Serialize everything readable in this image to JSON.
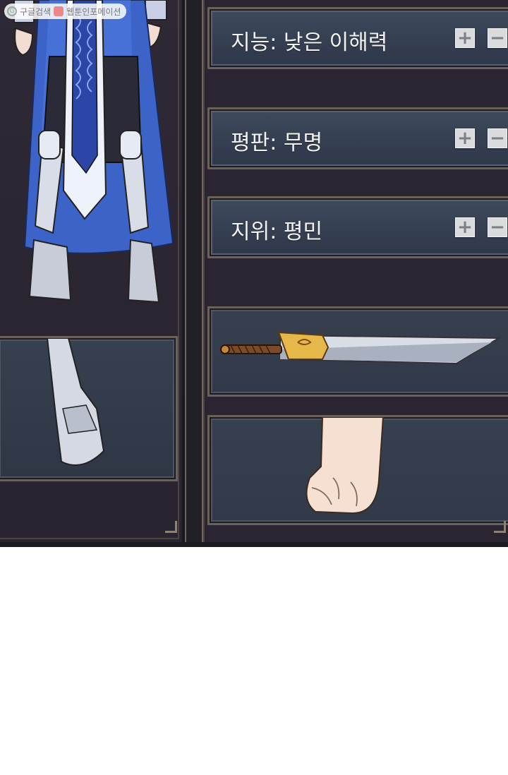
{
  "watermark": {
    "left_text": "구글검색",
    "right_text": "웹툰인포메이션"
  },
  "stats": [
    {
      "label": "지능: 낮은 이해력",
      "plus": "+",
      "minus": "−"
    },
    {
      "label": "평판: 무명",
      "plus": "+",
      "minus": "−"
    },
    {
      "label": "지위: 평민",
      "plus": "+",
      "minus": "−"
    }
  ],
  "equipment": {
    "weapon_slot": "dagger",
    "hand_slot": "fist"
  },
  "colors": {
    "panel_bg": "#2b2531",
    "stat_box": "#3f4a5c",
    "frame": "#6a6258",
    "button": "#d9dbdd",
    "text": "#f2f2f2"
  }
}
